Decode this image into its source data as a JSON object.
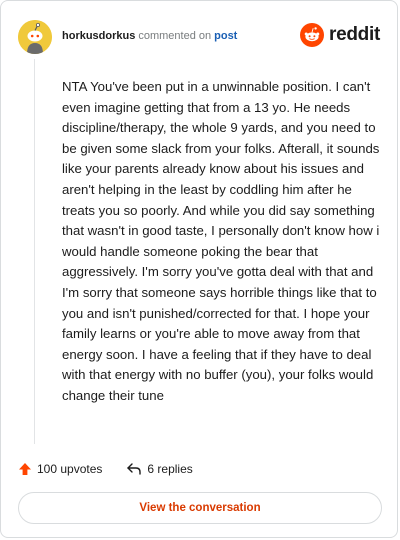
{
  "header": {
    "username": "horkusdorkus",
    "action_text": "commented on",
    "post_link": "post",
    "brand_name": "reddit",
    "brand_color": "#ff4500"
  },
  "comment": {
    "text": "NTA You've been put in a unwinnable position. I can't even imagine getting that from a 13 yo. He needs discipline/therapy, the whole 9 yards, and you need to be given some slack from your folks. Afterall, it sounds like your parents already know about his issues and aren't helping in the least by coddling him after he treats you so poorly. And while you did say something that wasn't in good taste, I personally don't know how i would handle someone poking the bear that aggressively. I'm sorry you've gotta deal with that and I'm sorry that someone says horrible things like that to you and isn't punished/corrected for that. I hope your family learns or you're able to move away from that energy soon. I have a feeling that if they have to deal with that energy with no buffer (you), your folks would change their tune"
  },
  "footer": {
    "upvotes": "100 upvotes",
    "replies": "6 replies",
    "upvote_icon": "upvote-arrow-icon",
    "reply_icon": "reply-arrow-icon",
    "accent_color": "#d93a00"
  },
  "cta": {
    "label": "View the conversation"
  }
}
